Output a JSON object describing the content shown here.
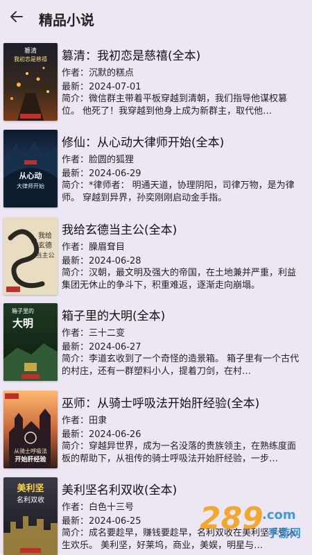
{
  "header": {
    "title": "精品小说",
    "back_icon": "arrow-left-icon"
  },
  "labels": {
    "author": "作者：",
    "latest": "最新：",
    "summary": "简介："
  },
  "books": [
    {
      "title": "篡清：我初恋是慈禧(全本)",
      "author": "沉默的糕点",
      "latest": "2024-07-01",
      "summary": "微信群主带着平板穿越到清朝，我们指导他谋权篡位。     他死了！我穿越到他身上成为新群主，取代他…",
      "cover_text": "篡清\n我初恋是慈禧"
    },
    {
      "title": "修仙：从心动大律师开始(全本)",
      "author": "脸圆的狐狸",
      "latest": "2024-06-29",
      "summary": "*律师者：       明通天道，协理阴阳，司律万物，是为律师。     穿越到异界，孙奕刚刚启动金手指。",
      "cover_text": "从心动\n大律师开始"
    },
    {
      "title": "我给玄德当主公(全本)",
      "author": "臊眉耷目",
      "latest": "2024-06-28",
      "summary": "汉朝，最文明及强大的帝国，在土地兼并严重，利益集团无休止的争斗下，积重难返，逐渐走向崩塌。",
      "cover_text": "我给玄德当主公"
    },
    {
      "title": "箱子里的大明(全本)",
      "author": "三十二变",
      "latest": "2024-06-27",
      "summary": "李道玄收到了一个奇怪的造景箱。     箱子里有一个古代的村庄，还有一群塑料小人，提着刀剑，在村…",
      "cover_text": "箱子里的\n大明"
    },
    {
      "title": "巫师：从骑士呼吸法开始肝经验(全本)",
      "author": "田隶",
      "latest": "2024-06-26",
      "summary": "穿越异世界，成为一名没落的贵族领主，在熟练度面板的帮助下，从祖传的骑士呼吸法开始肝经验，一步…",
      "cover_text": "从骑士呼吸法\n开始肝经验"
    },
    {
      "title": "美利坚名利双收(全本)",
      "author": "白色十三号",
      "latest": "2024-06-25",
      "summary": "成名要趁早，赚钱要趁早，名利双收在美利坚享受人生欢乐。     美利坚，好莱坞，商业，美娱，明星与…",
      "cover_text": "美利坚\n名利双收"
    }
  ],
  "watermark": {
    "main": "289",
    "sub": ".com",
    "caption": "手游网"
  }
}
